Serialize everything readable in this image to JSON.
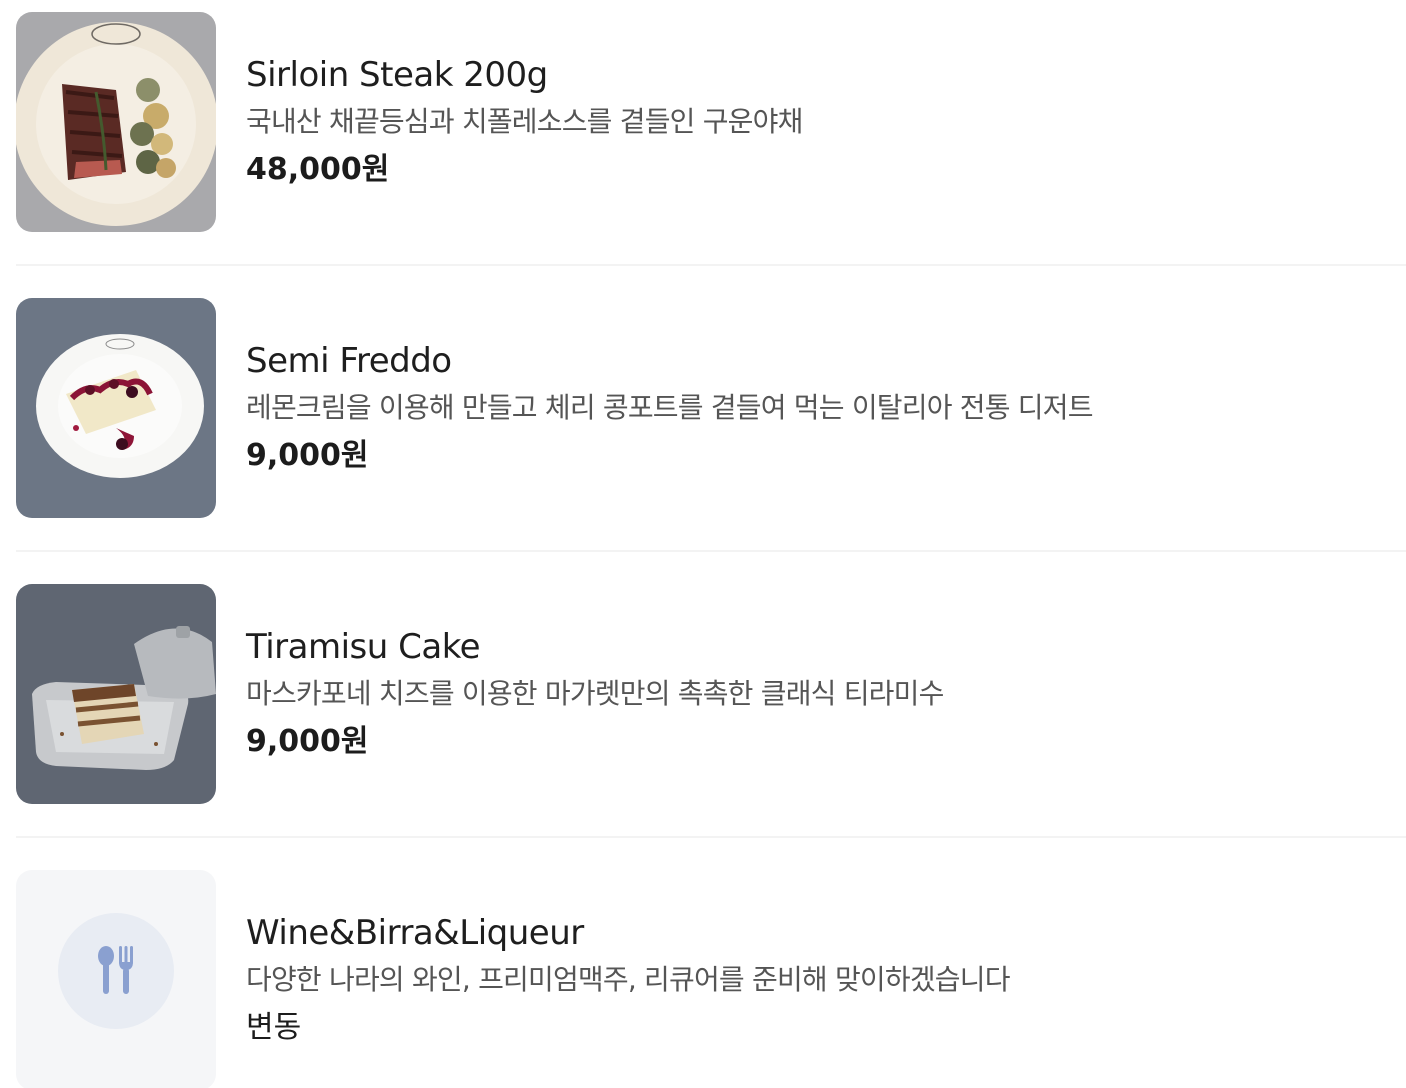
{
  "menu": {
    "items": [
      {
        "name": "Sirloin Steak 200g",
        "description": "국내산 채끝등심과 치폴레소스를 곁들인 구운야채",
        "price": "48,000원",
        "image_icon": "steak-plate-photo"
      },
      {
        "name": "Semi Freddo",
        "description": "레몬크림을 이용해 만들고 체리 콩포트를 곁들여 먹는 이탈리아 전통 디저트",
        "price": "9,000원",
        "image_icon": "dessert-plate-photo"
      },
      {
        "name": "Tiramisu Cake",
        "description": "마스카포네 치즈를 이용한 마가렛만의 촉촉한 클래식 티라미수",
        "price": "9,000원",
        "image_icon": "tiramisu-photo"
      },
      {
        "name": "Wine&Birra&Liqueur",
        "description": "다양한 나라의 와인, 프리미엄맥주, 리큐어를 준비해 맞이하겠습니다",
        "price": "변동",
        "image_icon": "fork-spoon-icon"
      }
    ]
  },
  "colors": {
    "text_primary": "#1e1e1e",
    "text_secondary": "#555555",
    "divider": "#f3f3f3",
    "placeholder_bg": "#f5f6f8",
    "placeholder_icon": "#8aa0d0"
  }
}
